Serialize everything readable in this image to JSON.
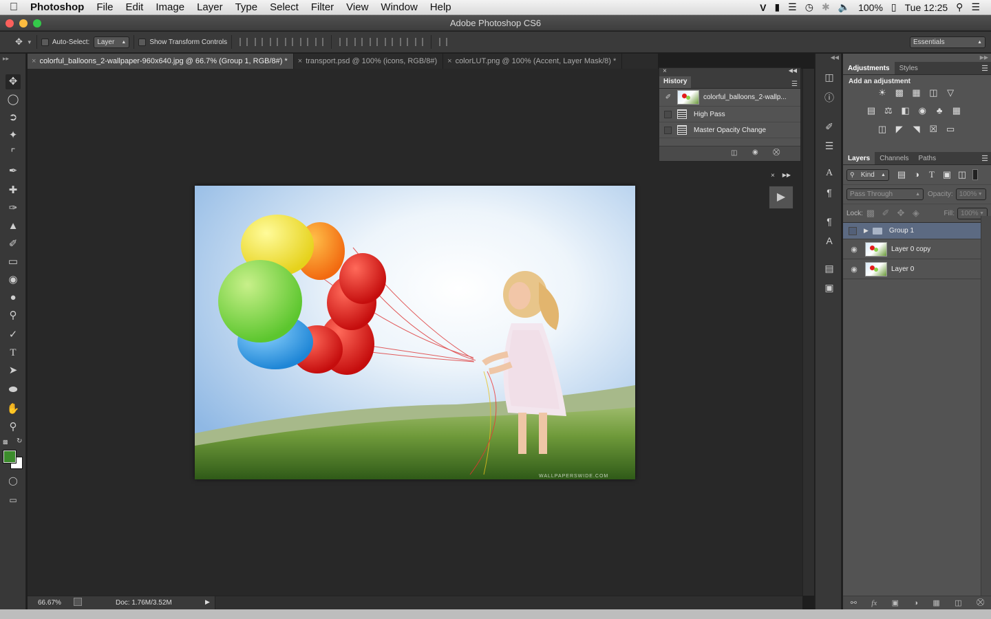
{
  "menubar": {
    "app": "Photoshop",
    "items": [
      "File",
      "Edit",
      "Image",
      "Layer",
      "Type",
      "Select",
      "Filter",
      "View",
      "Window",
      "Help"
    ],
    "status": {
      "battery": "100%",
      "clock": "Tue 12:25"
    }
  },
  "window": {
    "title": "Adobe Photoshop CS6"
  },
  "options": {
    "auto_select_label": "Auto-Select:",
    "auto_select_value": "Layer",
    "transform_label": "Show Transform Controls",
    "workspace": "Essentials"
  },
  "doc_tabs": [
    {
      "label": "colorful_balloons_2-wallpaper-960x640.jpg @ 66.7% (Group 1, RGB/8#) *"
    },
    {
      "label": "transport.psd @ 100% (icons, RGB/8#)"
    },
    {
      "label": "colorLUT.png @ 100% (Accent, Layer Mask/8) *"
    }
  ],
  "status": {
    "zoom": "66.67%",
    "doc": "Doc: 1.76M/3.52M"
  },
  "history": {
    "title": "History",
    "snapshot": "colorful_balloons_2-wallp...",
    "states": [
      "High Pass",
      "Master Opacity Change"
    ]
  },
  "adjustments": {
    "tabs": [
      "Adjustments",
      "Styles"
    ],
    "heading": "Add an adjustment"
  },
  "layers": {
    "tabs": [
      "Layers",
      "Channels",
      "Paths"
    ],
    "filter": "Kind",
    "blend": "Pass Through",
    "opacity_label": "Opacity:",
    "opacity": "100%",
    "lock_label": "Lock:",
    "fill_label": "Fill:",
    "fill": "100%",
    "items": [
      {
        "name": "Group 1"
      },
      {
        "name": "Layer 0 copy"
      },
      {
        "name": "Layer 0"
      }
    ]
  },
  "colors": {
    "foreground": "#3c8c2c",
    "background": "#ffffff"
  }
}
